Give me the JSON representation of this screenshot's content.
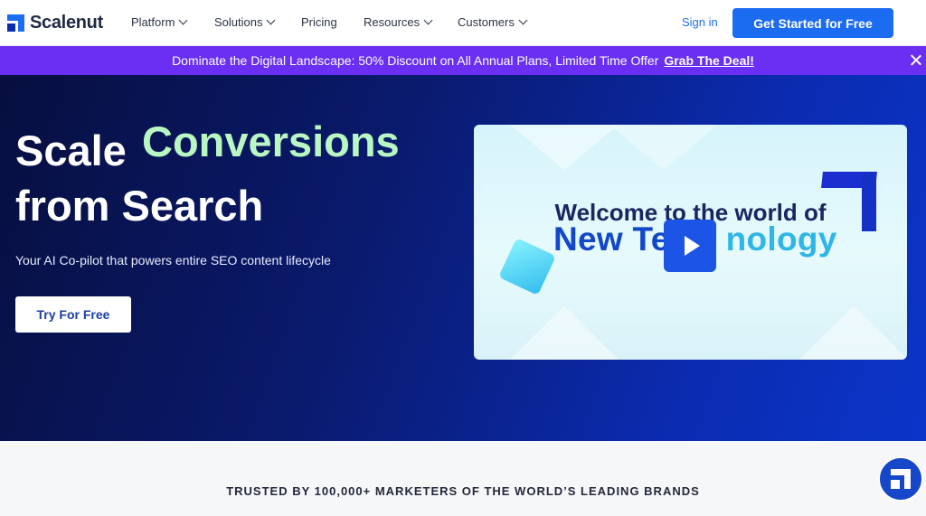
{
  "brand": {
    "name": "Scalenut",
    "accent": "#1c6cf2"
  },
  "nav": {
    "items": [
      {
        "label": "Platform",
        "dropdown": true
      },
      {
        "label": "Solutions",
        "dropdown": true
      },
      {
        "label": "Pricing",
        "dropdown": false
      },
      {
        "label": "Resources",
        "dropdown": true
      },
      {
        "label": "Customers",
        "dropdown": true
      }
    ],
    "sign_in": "Sign in",
    "cta": "Get Started for Free"
  },
  "promo": {
    "text": "Dominate the Digital Landscape: 50% Discount on All Annual Plans, Limited Time Offer",
    "link": "Grab The Deal!",
    "bg": "#6a2ff2"
  },
  "hero": {
    "line1": "Scale",
    "accent": "Conversions",
    "line2": "from Search",
    "subtitle": "Your AI Co-pilot that powers entire SEO content lifecycle",
    "button": "Try For Free",
    "video": {
      "title1": "Welcome to the world of",
      "title2a": "New Te",
      "title2b": "nology"
    }
  },
  "trusted": {
    "text": "TRUSTED BY 100,000+ MARKETERS OF THE WORLD’S LEADING BRANDS"
  }
}
